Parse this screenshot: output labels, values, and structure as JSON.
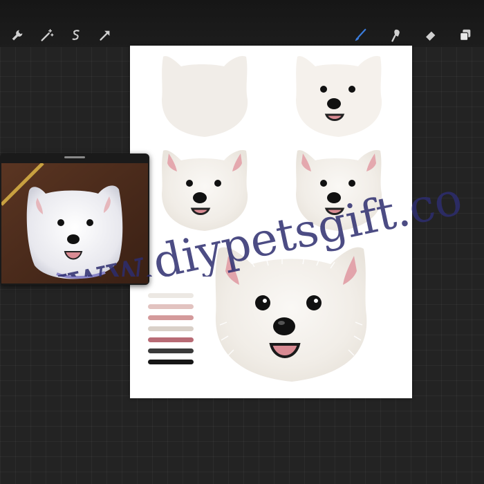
{
  "toolbar": {
    "left_tools": [
      {
        "name": "actions",
        "icon": "wrench-icon"
      },
      {
        "name": "adjustments",
        "icon": "magic-wand-icon"
      },
      {
        "name": "selection",
        "icon": "selection-s-icon"
      },
      {
        "name": "transform",
        "icon": "arrow-cursor-icon"
      }
    ],
    "right_tools": [
      {
        "name": "brush",
        "icon": "brush-icon",
        "active": true
      },
      {
        "name": "smudge",
        "icon": "smudge-icon"
      },
      {
        "name": "eraser",
        "icon": "eraser-icon"
      },
      {
        "name": "layers",
        "icon": "layers-icon"
      }
    ],
    "active_color": "#3b7ddd"
  },
  "canvas": {
    "background": "#ffffff",
    "swatches": [
      "#ece8e3",
      "#e2c3c0",
      "#d49a9b",
      "#d9d0c8",
      "#b86b75",
      "#3a3a3a",
      "#161616"
    ]
  },
  "reference": {
    "handle": true
  },
  "watermark": {
    "text": "www.diypetsgift.co",
    "color": "#2d2d6e"
  }
}
